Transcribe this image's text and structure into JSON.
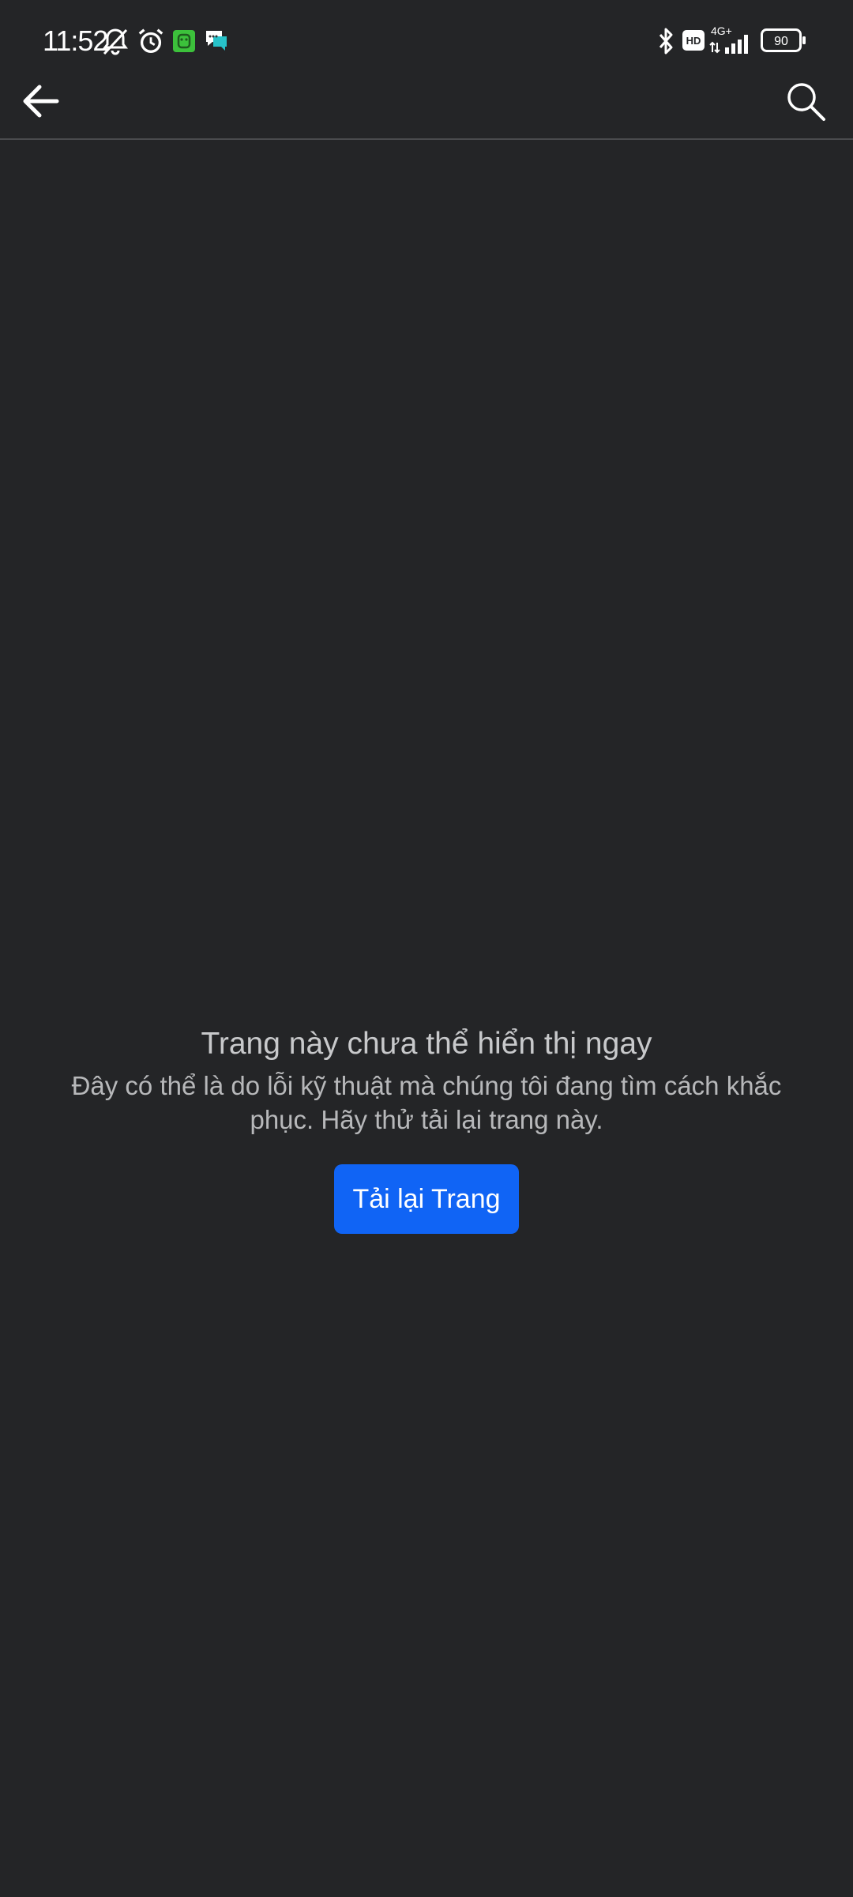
{
  "status_bar": {
    "time": "11:52",
    "battery": "90",
    "network": "4G+",
    "hd_label": "HD",
    "icons": [
      "muted-bell-icon",
      "alarm-icon",
      "green-app-notification-icon",
      "chat-notification-icon",
      "bluetooth-icon",
      "hd-voice-icon",
      "signal-icon",
      "battery-icon"
    ]
  },
  "app_bar": {
    "back_icon": "arrow-left-icon",
    "search_icon": "search-icon"
  },
  "error": {
    "title": "Trang này chưa thể hiển thị ngay",
    "description": "Đây có thể là do lỗi kỹ thuật mà chúng tôi đang tìm cách khắc phục. Hãy thử tải lại trang này.",
    "reload_label": "Tải lại Trang"
  },
  "colors": {
    "background": "#242527",
    "button": "#1064f5",
    "title_text": "#c8c9cb",
    "body_text": "#b7b8ba"
  }
}
